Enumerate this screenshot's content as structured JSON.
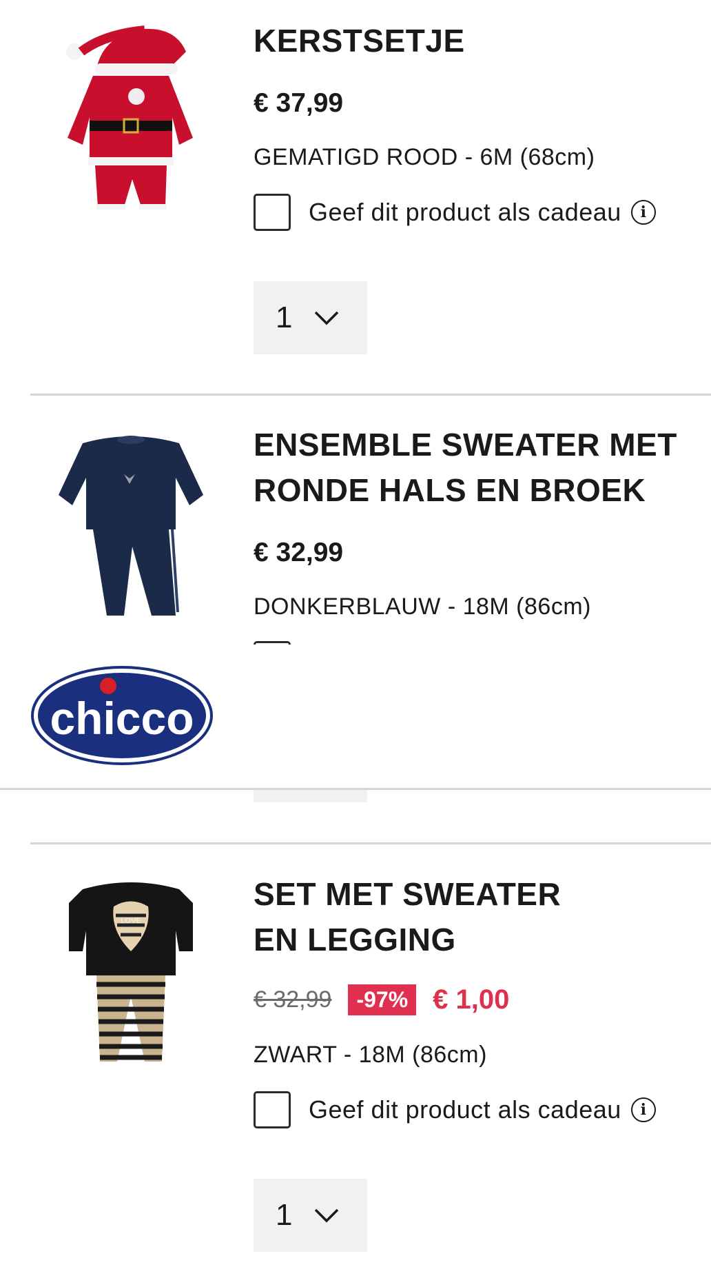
{
  "brand": {
    "logo_text": "chicco"
  },
  "items": [
    {
      "title": "KERSTSETJE",
      "price": "€ 37,99",
      "variant": "GEMATIGD ROOD - 6M (68cm)",
      "gift_label": "Geef dit product als cadeau",
      "quantity": "1",
      "image": "santa-outfit-image",
      "color": "#c8102e"
    },
    {
      "title": "ENSEMBLE SWEATER MET RONDE HALS EN BROEK",
      "price": "€ 32,99",
      "variant": "DONKERBLAUW - 18M (86cm)",
      "image": "navy-sweater-set-image",
      "color": "#1c2a4a"
    },
    {
      "title": "SET MET SWEATER EN LEGGING",
      "old_price": "€ 32,99",
      "discount": "-97%",
      "sale_price": "€ 1,00",
      "variant": "ZWART - 18M (86cm)",
      "gift_label": "Geef dit product als cadeau",
      "quantity": "1",
      "image": "black-sweater-legging-set-image",
      "color": "#e03050"
    }
  ],
  "info_icon_glyph": "i"
}
